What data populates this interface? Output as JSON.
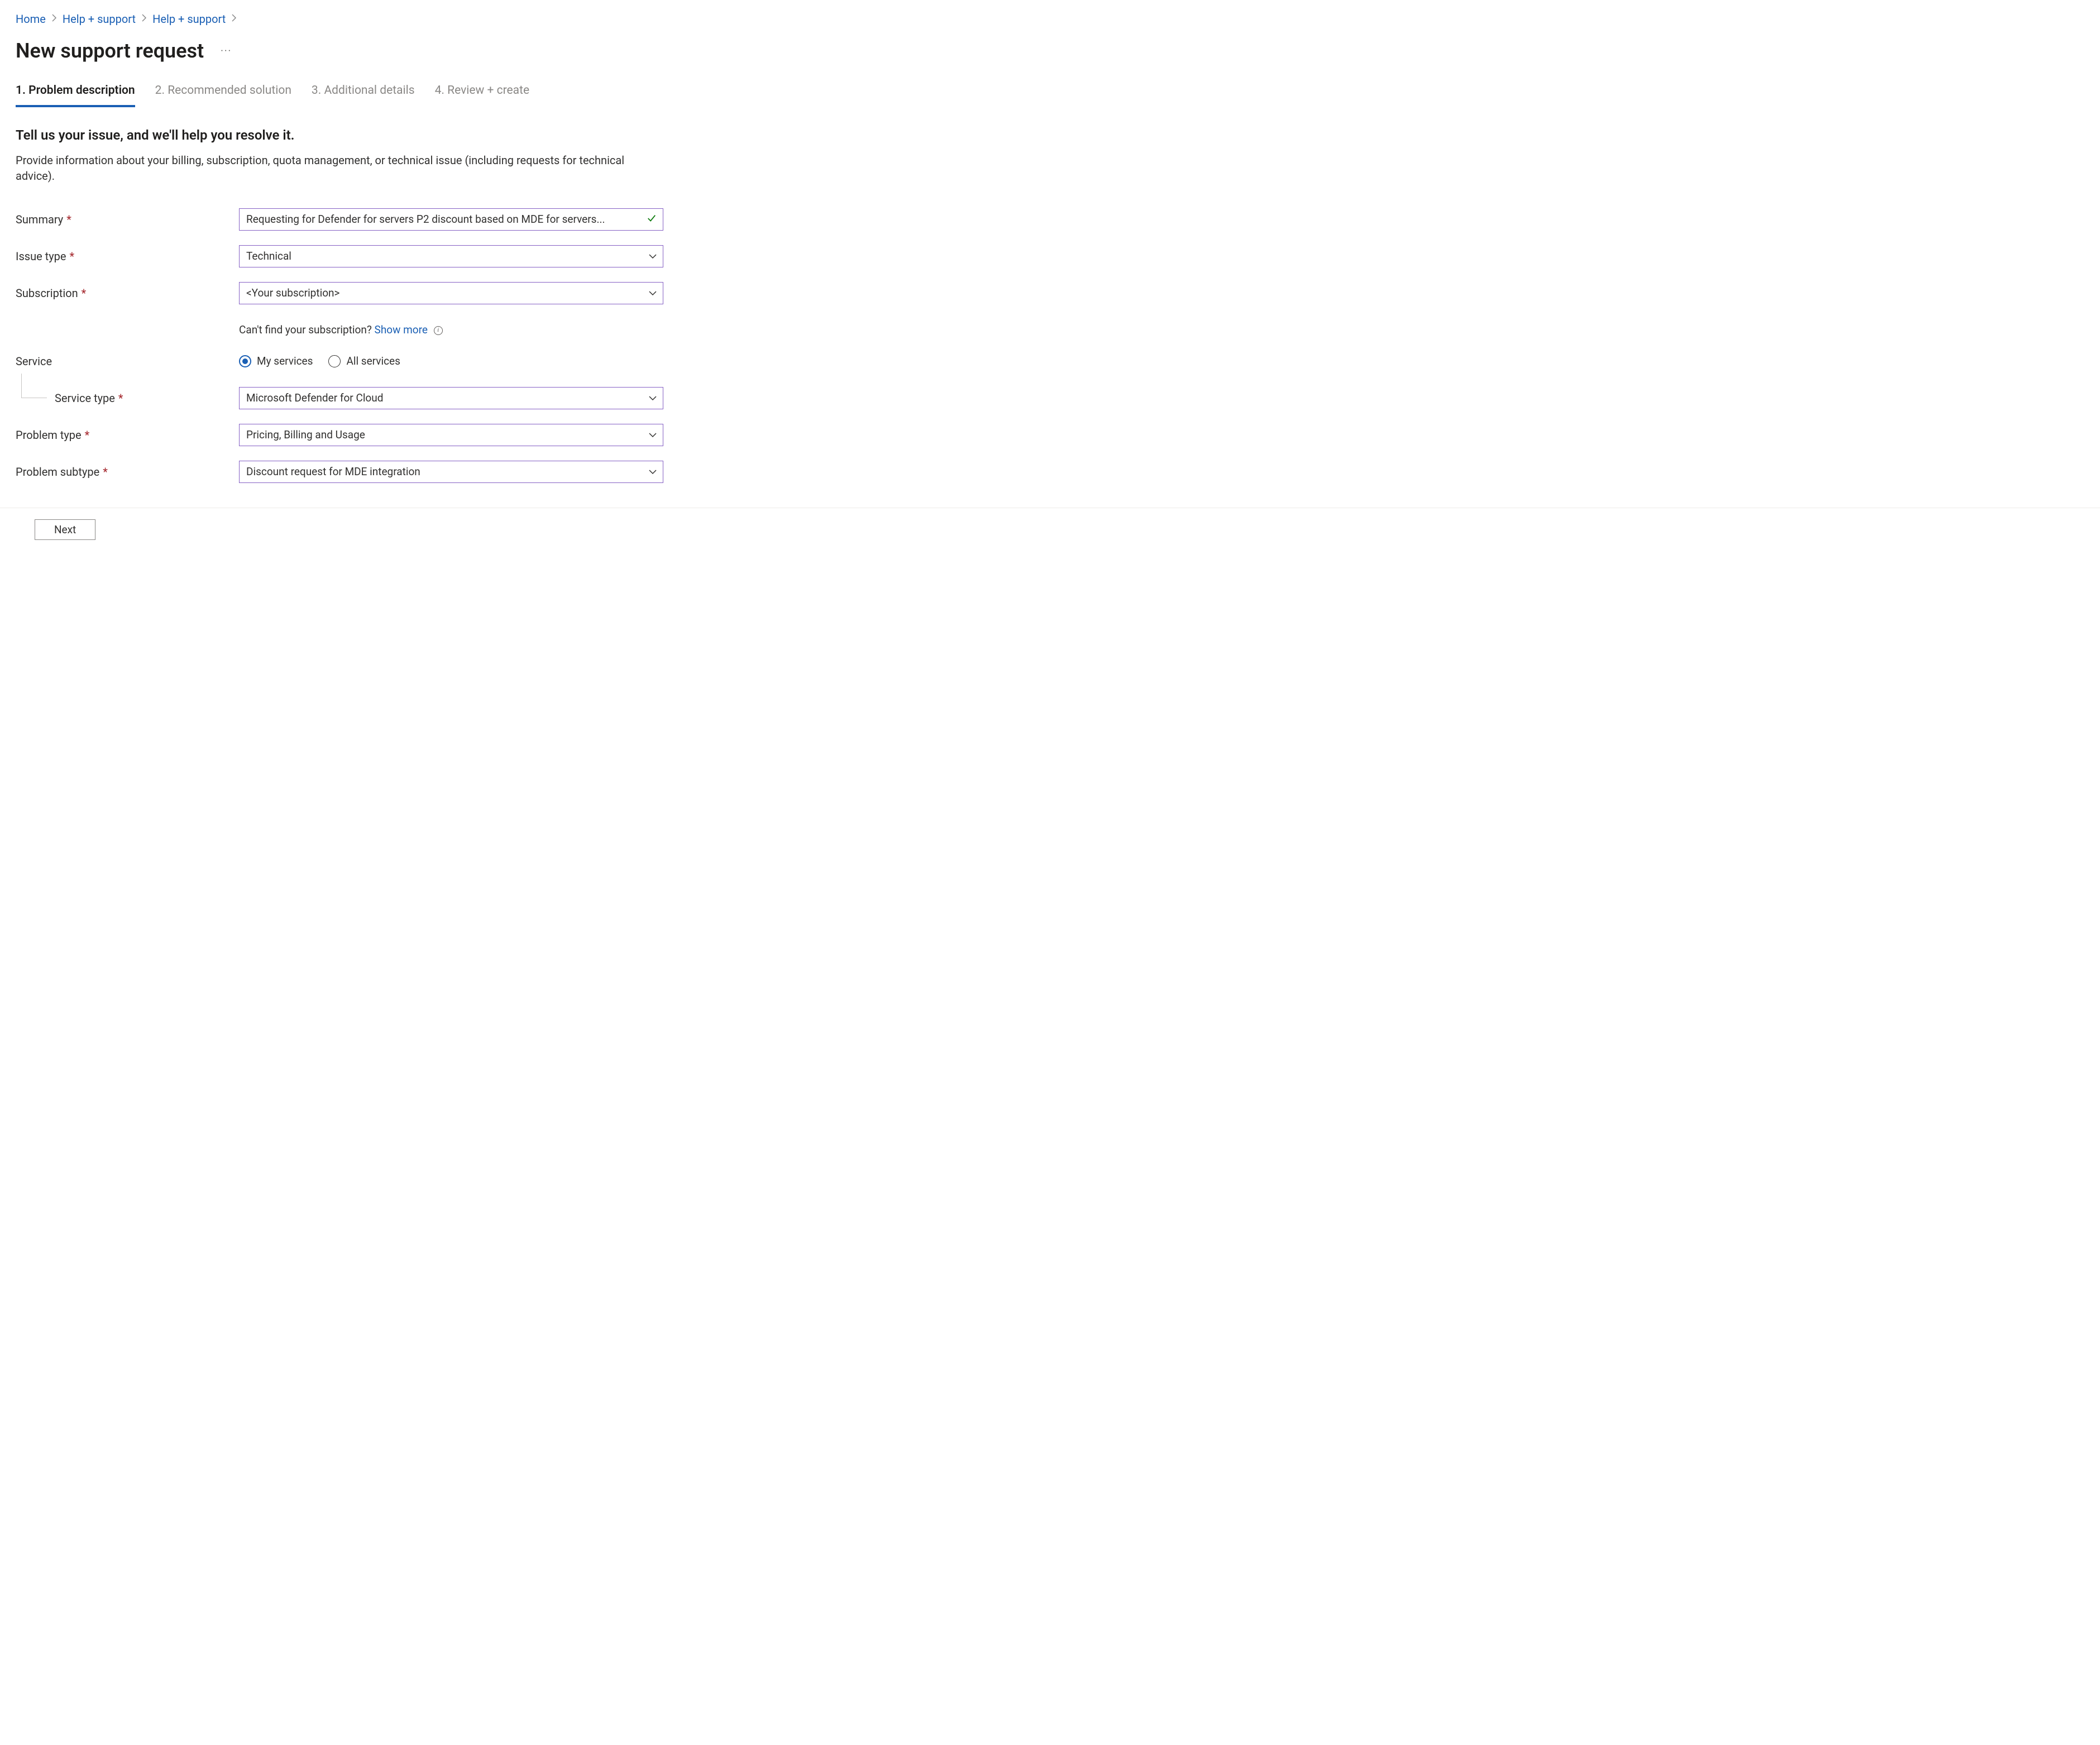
{
  "breadcrumb": {
    "items": [
      "Home",
      "Help + support",
      "Help + support"
    ]
  },
  "page": {
    "title": "New support request",
    "more_label": "···"
  },
  "tabs": [
    {
      "label": "1. Problem description",
      "active": true
    },
    {
      "label": "2. Recommended solution",
      "active": false
    },
    {
      "label": "3. Additional details",
      "active": false
    },
    {
      "label": "4. Review + create",
      "active": false
    }
  ],
  "intro": {
    "title": "Tell us your issue, and we'll help you resolve it.",
    "description": "Provide information about your billing, subscription, quota management, or technical issue (including requests for technical advice)."
  },
  "form": {
    "summary": {
      "label": "Summary",
      "value": "Requesting for Defender for servers P2 discount based on MDE for servers..."
    },
    "issue_type": {
      "label": "Issue type",
      "value": "Technical"
    },
    "subscription": {
      "label": "Subscription",
      "value": "<Your subscription>",
      "helper_prefix": "Can't find your subscription? ",
      "helper_link": "Show more"
    },
    "service": {
      "label": "Service",
      "options": [
        {
          "label": "My services",
          "checked": true
        },
        {
          "label": "All services",
          "checked": false
        }
      ]
    },
    "service_type": {
      "label": "Service type",
      "value": "Microsoft Defender for Cloud"
    },
    "problem_type": {
      "label": "Problem type",
      "value": "Pricing, Billing and Usage"
    },
    "problem_subtype": {
      "label": "Problem subtype",
      "value": "Discount request for MDE integration"
    }
  },
  "footer": {
    "next_label": "Next"
  }
}
